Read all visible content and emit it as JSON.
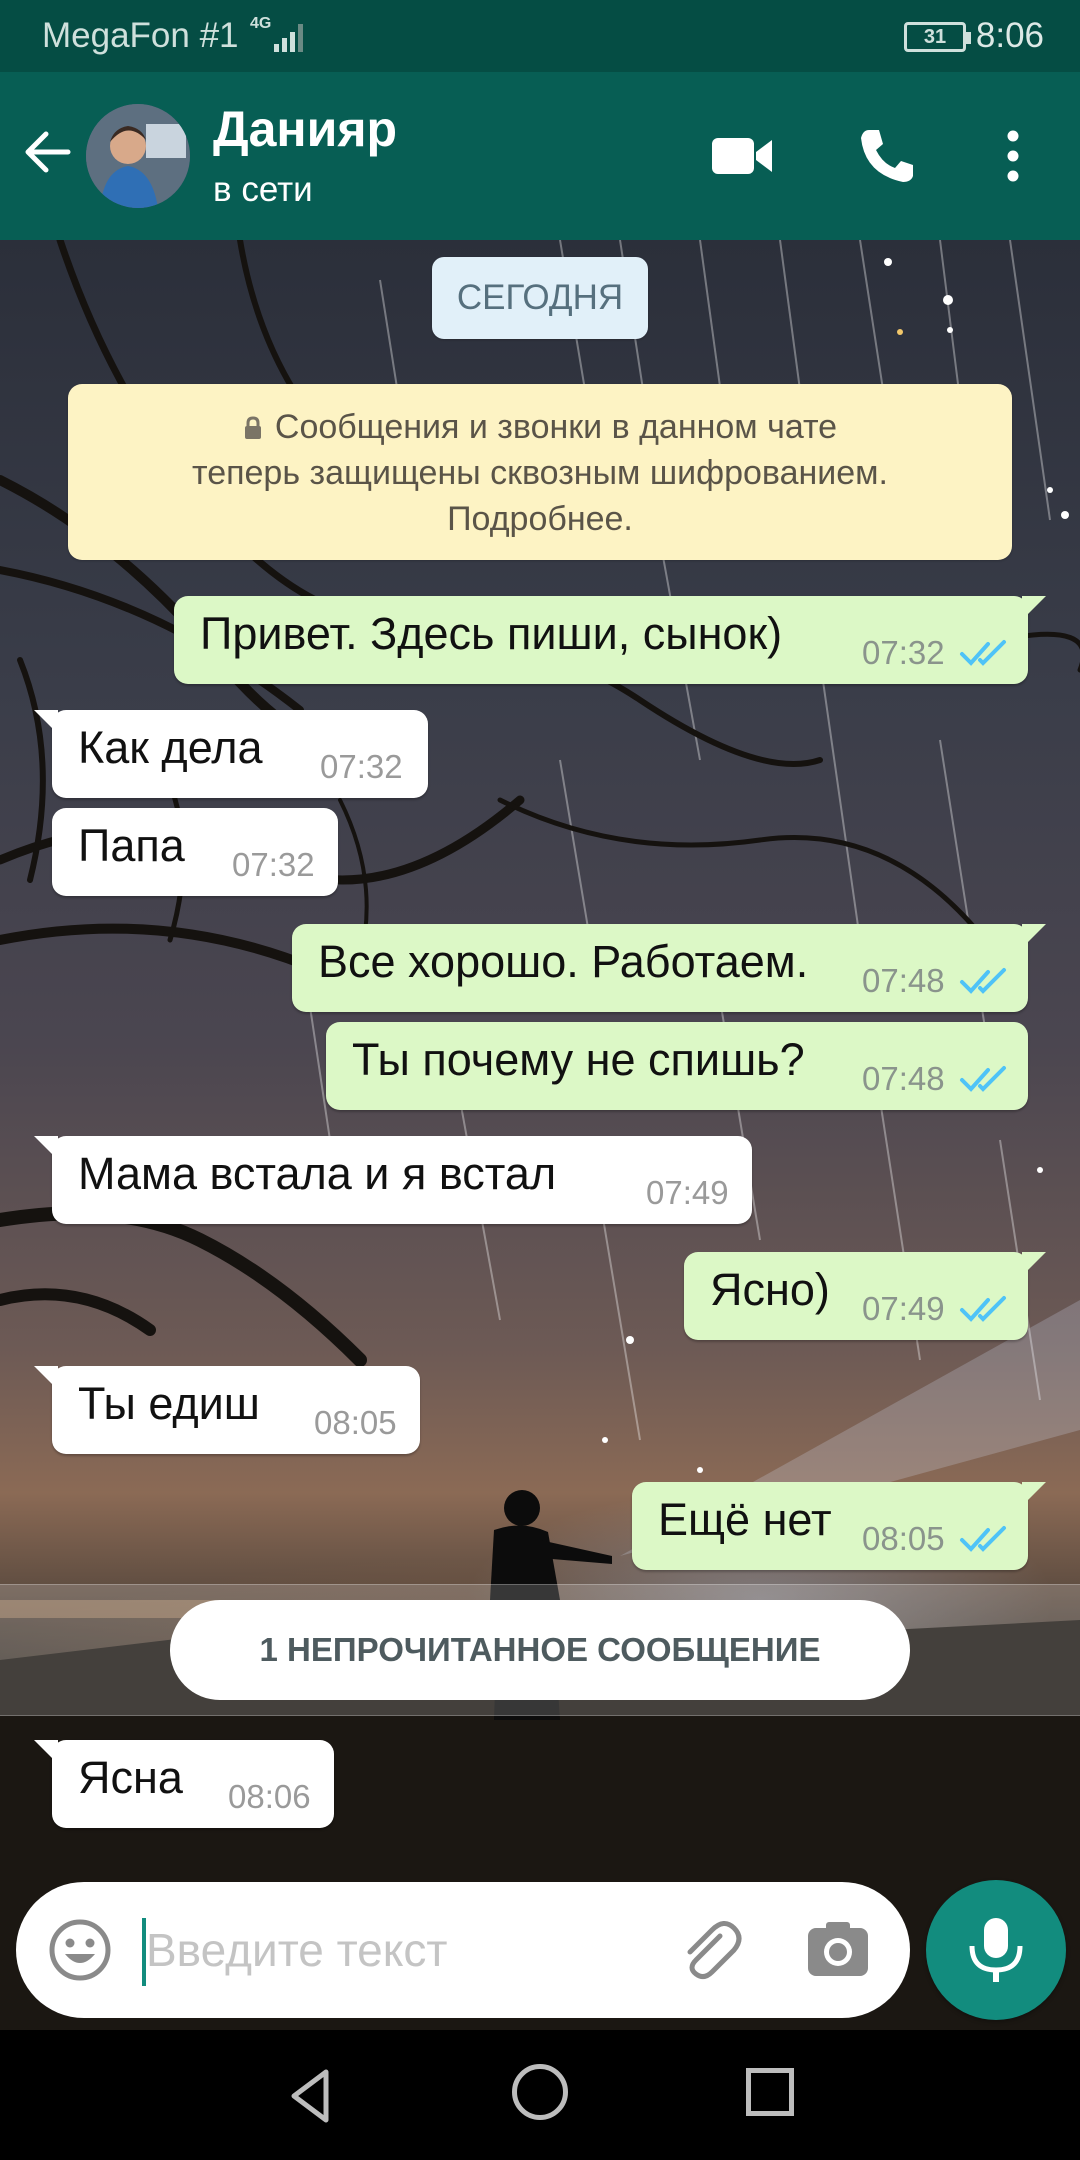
{
  "status_bar": {
    "carrier": "MegaFon #1",
    "network": "4G",
    "battery": "31",
    "time": "8:06"
  },
  "header": {
    "contact_name": "Данияр",
    "contact_status": "в сети"
  },
  "chat": {
    "date_label": "СЕГОДНЯ",
    "encryption_notice": [
      "Сообщения и звонки в данном чате",
      "теперь защищены сквозным шифрованием.",
      "Подробнее."
    ],
    "messages": [
      {
        "direction": "out",
        "text": "Привет. Здесь пиши, сынок)",
        "time": "07:32",
        "status": "read"
      },
      {
        "direction": "in",
        "text": "Как дела",
        "time": "07:32"
      },
      {
        "direction": "in",
        "text": "Папа",
        "time": "07:32"
      },
      {
        "direction": "out",
        "text": "Все хорошо. Работаем.",
        "time": "07:48",
        "status": "read"
      },
      {
        "direction": "out",
        "text": "Ты почему не спишь?",
        "time": "07:48",
        "status": "read"
      },
      {
        "direction": "in",
        "text": "Мама встала  и я встал",
        "time": "07:49"
      },
      {
        "direction": "out",
        "text": "Ясно)",
        "time": "07:49",
        "status": "read"
      },
      {
        "direction": "in",
        "text": "Ты едиш",
        "time": "08:05"
      },
      {
        "direction": "out",
        "text": "Ещё нет",
        "time": "08:05",
        "status": "read"
      },
      {
        "direction": "in",
        "text": "Ясна",
        "time": "08:06"
      }
    ],
    "unread_label": "1 НЕПРОЧИТАННОЕ СООБЩЕНИЕ"
  },
  "input": {
    "placeholder": "Введите текст",
    "value": ""
  },
  "icons": {
    "back": "arrow-left-icon",
    "video": "video-camera-icon",
    "call": "phone-icon",
    "more": "more-vert-icon",
    "emoji": "emoji-icon",
    "attach": "paperclip-icon",
    "camera": "camera-icon",
    "mic": "microphone-icon",
    "read_receipt": "double-check-icon",
    "lock": "lock-icon"
  },
  "colors": {
    "header": "#075e54",
    "status_bar": "#054d44",
    "outgoing_bubble": "#dcf8c6",
    "incoming_bubble": "#ffffff",
    "accent": "#128c7e",
    "read_ticks": "#4fc3f7"
  }
}
